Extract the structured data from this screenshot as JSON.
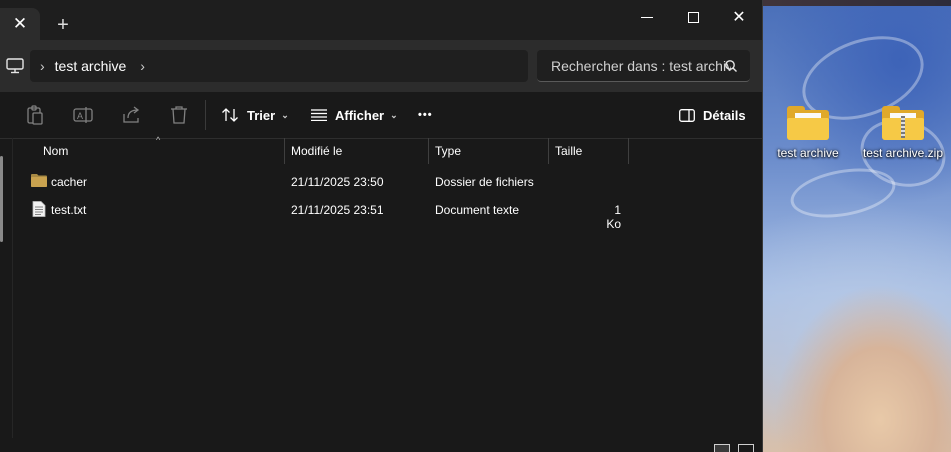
{
  "desktop": {
    "icons": [
      {
        "label": "test archive",
        "icon": "folder-icon"
      },
      {
        "label": "test archive.zip",
        "icon": "zip-folder-icon"
      }
    ]
  },
  "window": {
    "tab_close_glyph": "✕",
    "new_tab_glyph": "+",
    "close_glyph": "✕",
    "address": {
      "root_icon": "computer-icon",
      "crumbs": [
        "test archive"
      ]
    },
    "search": {
      "placeholder": "Rechercher dans : test archive"
    },
    "toolbar": {
      "sort_label": "Trier",
      "view_label": "Afficher",
      "more_glyph": "•••",
      "details_label": "Détails"
    },
    "columns": {
      "name": "Nom",
      "modified": "Modifié le",
      "type": "Type",
      "size": "Taille"
    },
    "files": [
      {
        "name": "cacher",
        "modified": "21/11/2025 23:50",
        "type": "Dossier de fichiers",
        "size": "",
        "icon": "folder-icon"
      },
      {
        "name": "test.txt",
        "modified": "21/11/2025 23:51",
        "type": "Document texte",
        "size": "1 Ko",
        "icon": "text-file-icon"
      }
    ]
  },
  "colors": {
    "window_bg": "#191919",
    "folder": "#e0a92b"
  }
}
